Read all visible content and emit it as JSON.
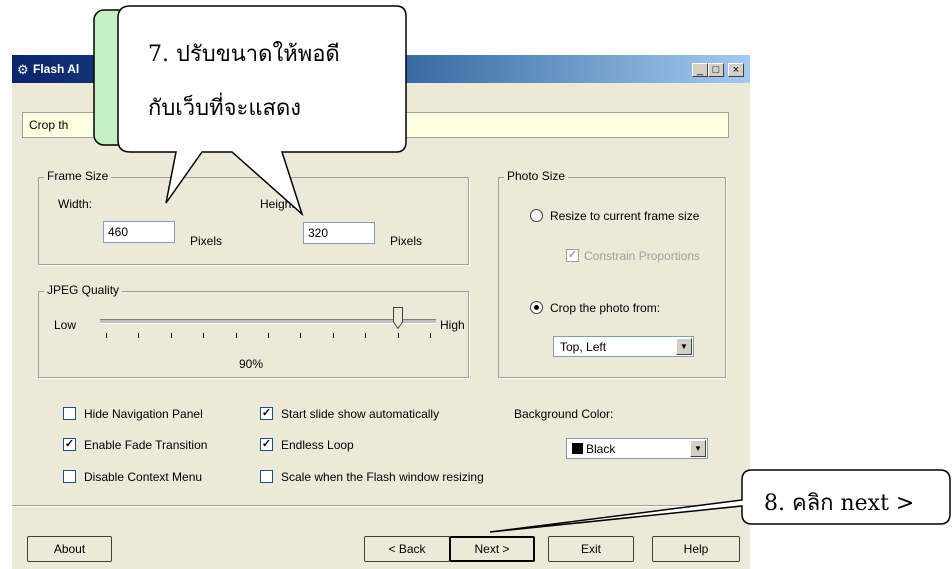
{
  "window": {
    "title": "Flash Al",
    "minimize": "_",
    "maximize": "□",
    "close": "×"
  },
  "description": "Crop th",
  "frame_size": {
    "legend": "Frame Size",
    "width_label": "Width:",
    "width_value": "460",
    "width_unit": "Pixels",
    "height_label": "Height",
    "height_value": "320",
    "height_unit": "Pixels"
  },
  "jpeg_quality": {
    "legend": "JPEG Quality",
    "low_label": "Low",
    "high_label": "High",
    "value_label": "90%",
    "value": 0.9
  },
  "photo_size": {
    "legend": "Photo Size",
    "resize_label": "Resize to current frame size",
    "constrain_label": "Constrain Proportions",
    "crop_label": "Crop the photo from:",
    "crop_value": "Top, Left"
  },
  "options": {
    "hide_nav": "Hide Navigation Panel",
    "fade": "Enable Fade Transition",
    "disable_menu": "Disable Context Menu",
    "start_auto": "Start slide show automatically",
    "endless": "Endless Loop",
    "scale": "Scale when the Flash window resizing",
    "check_mark": "✓"
  },
  "background": {
    "label": "Background Color:",
    "value": "Black",
    "swatch_color": "#000000"
  },
  "buttons": {
    "about": "About",
    "back": "< Back",
    "next": "Next >",
    "exit": "Exit",
    "help": "Help"
  },
  "callouts": {
    "step7_line1": "7. ปรับขนาดให้พอดี",
    "step7_line2": "กับเว็บที่จะแสดง",
    "step8": "8. คลิก  next >",
    "fill_color": "#c6f0c6"
  }
}
